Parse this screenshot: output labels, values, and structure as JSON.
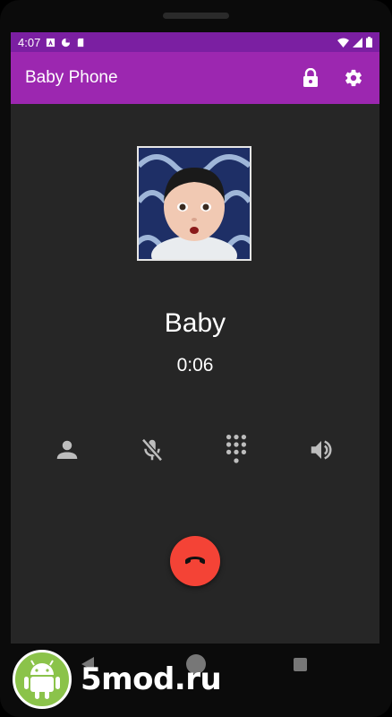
{
  "status_bar": {
    "time": "4:07",
    "icons": [
      "a-notification-icon",
      "app-notification-icon",
      "sd-card-icon",
      "wifi-icon",
      "signal-icon",
      "battery-icon"
    ]
  },
  "app_bar": {
    "title": "Baby Phone",
    "actions": [
      "lock-icon",
      "settings-icon"
    ],
    "color": "#9c27b0",
    "status_color": "#7b1fa2"
  },
  "call": {
    "caller_name": "Baby",
    "duration": "0:06",
    "controls": [
      "contact-icon",
      "mic-off-icon",
      "dialpad-icon",
      "speaker-icon"
    ],
    "end_call_icon": "call-end-icon",
    "end_call_color": "#f44336"
  },
  "navigation": [
    "back-icon",
    "home-icon",
    "recents-icon"
  ],
  "watermark": {
    "text": "5mod.ru",
    "logo": "android-robot-icon",
    "logo_color": "#8bc34a"
  }
}
